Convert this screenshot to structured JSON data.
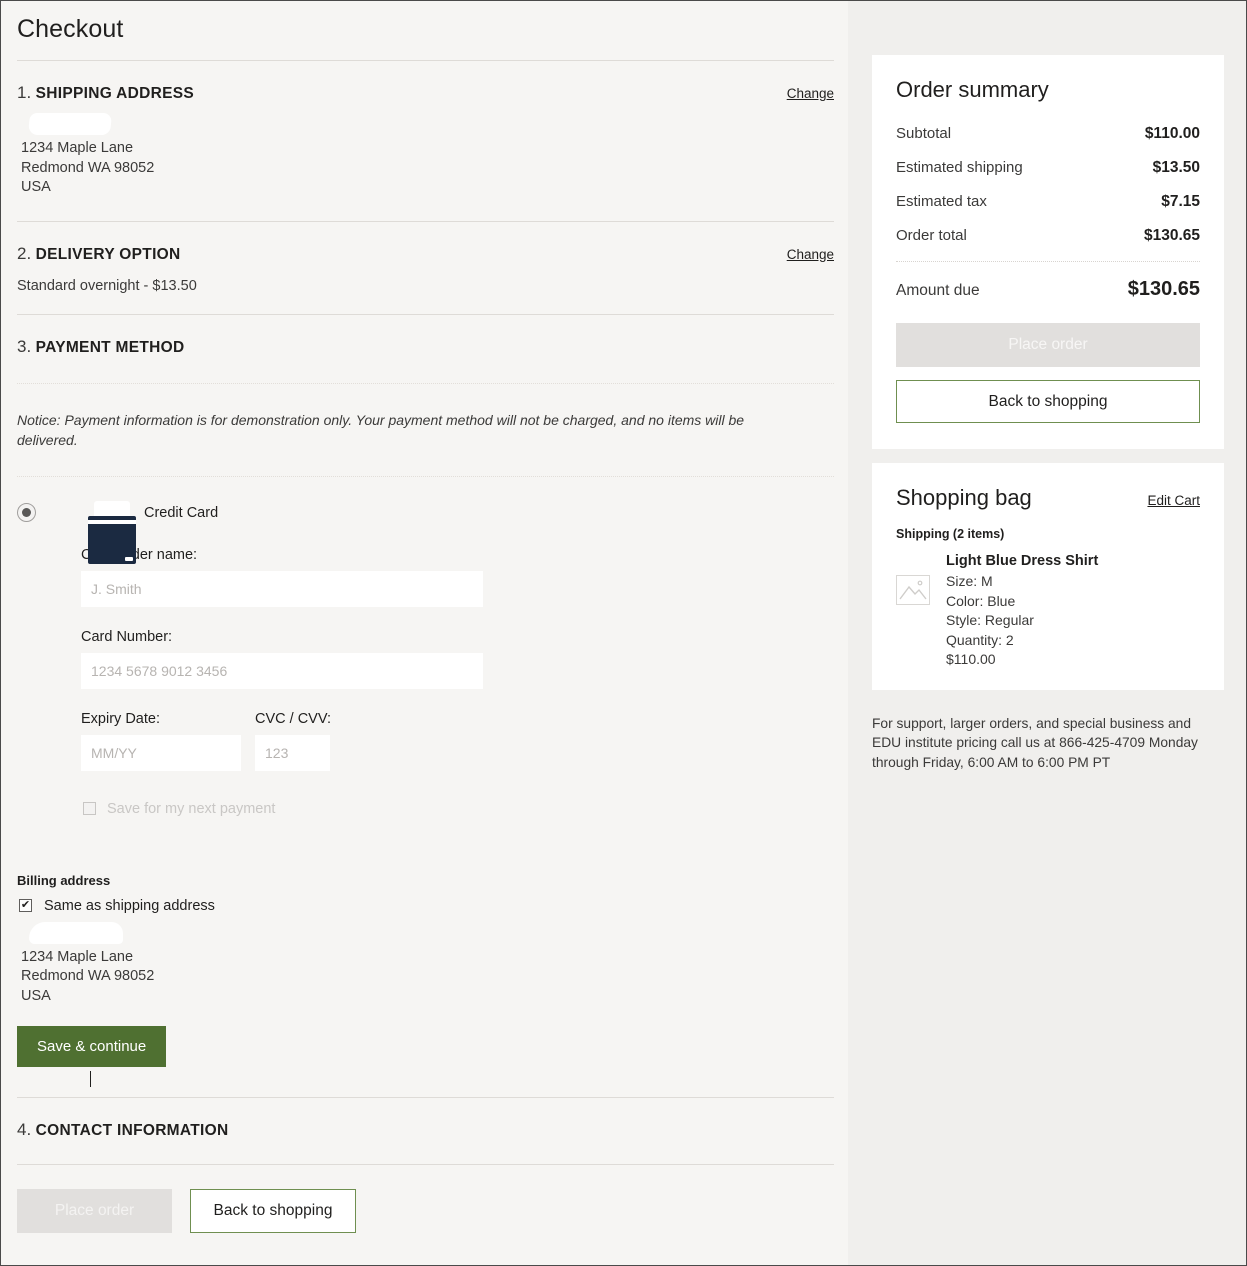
{
  "page": {
    "title": "Checkout"
  },
  "sections": {
    "shipping": {
      "num": "1.",
      "title": "SHIPPING ADDRESS",
      "change_label": "Change",
      "address_line1": "1234 Maple Lane",
      "address_line2": "Redmond WA 98052",
      "address_line3": "USA"
    },
    "delivery": {
      "num": "2.",
      "title": "DELIVERY OPTION",
      "change_label": "Change",
      "value": "Standard overnight -  $13.50"
    },
    "payment": {
      "num": "3.",
      "title": "PAYMENT METHOD",
      "notice": "Notice: Payment information is for demonstration only.  Your payment method will not be charged, and no items will be delivered.",
      "method_label": "Credit Card",
      "cardholder_label": "Cardholder name:",
      "cardholder_value": "",
      "cardholder_placeholder": "J. Smith",
      "card_number_label": "Card Number:",
      "card_number_value": "",
      "card_number_placeholder": "1234 5678 9012 3456",
      "expiry_label": "Expiry Date:",
      "expiry_value": "",
      "expiry_placeholder": "MM/YY",
      "cvc_label": "CVC / CVV:",
      "cvc_value": "",
      "cvc_placeholder": "123",
      "save_next_label": "Save for my next payment",
      "billing_title": "Billing address",
      "same_as_shipping_label": "Same as shipping address",
      "billing_line1": "1234 Maple Lane",
      "billing_line2": "Redmond WA 98052",
      "billing_line3": "USA",
      "save_continue_label": "Save & continue"
    },
    "contact": {
      "num": "4.",
      "title": "CONTACT INFORMATION"
    }
  },
  "footer": {
    "place_order_label": "Place order",
    "back_to_shopping_label": "Back to shopping"
  },
  "order_summary": {
    "title": "Order summary",
    "rows": [
      {
        "label": "Subtotal",
        "value": "$110.00"
      },
      {
        "label": "Estimated shipping",
        "value": "$13.50"
      },
      {
        "label": "Estimated tax",
        "value": "$7.15"
      },
      {
        "label": "Order total",
        "value": "$130.65"
      }
    ],
    "amount_due_label": "Amount due",
    "amount_due_value": "$130.65",
    "place_order_label": "Place order",
    "back_to_shopping_label": "Back to shopping"
  },
  "shopping_bag": {
    "title": "Shopping bag",
    "edit_cart_label": "Edit Cart",
    "shipping_items_label": "Shipping (2 items)",
    "item": {
      "name": "Light Blue Dress Shirt",
      "size": "Size: M",
      "color": "Color: Blue",
      "style": "Style: Regular",
      "quantity": "Quantity: 2",
      "price": "$110.00"
    }
  },
  "support": {
    "text": "For support, larger orders, and special business and EDU institute pricing call us at 866-425-4709 Monday through Friday, 6:00 AM to 6:00 PM PT"
  },
  "colors": {
    "accent_green": "#4f7031",
    "outline_green": "#6f8f50",
    "page_bg": "#f6f5f3",
    "panel_bg": "#f0efed"
  }
}
